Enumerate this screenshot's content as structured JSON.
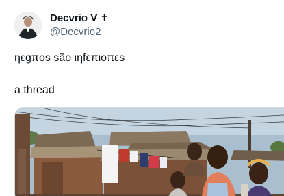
{
  "author": {
    "display_name": "Decvrio V ✝",
    "handle": "@Decvrio2"
  },
  "tweet": {
    "text_line_1": "ηεgπos são ιηfεπιoπεs",
    "text_line_2": "a thread"
  },
  "media": {
    "subject": "photo of children standing in front of corrugated-roof houses with laundry on a line"
  },
  "colors": {
    "text_primary": "#0f1419",
    "text_secondary": "#536471",
    "border": "#cfd9de"
  }
}
